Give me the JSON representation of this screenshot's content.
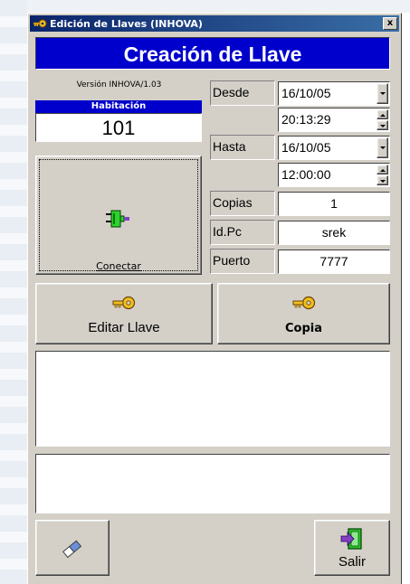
{
  "window": {
    "title": "Edición de Llaves (INHOVA)",
    "close_label": "x"
  },
  "banner": {
    "title": "Creación de Llave"
  },
  "version": "Versión INHOVA/1.03",
  "habitacion": {
    "label": "Habitación",
    "value": "101"
  },
  "conectar": {
    "label": "Conectar"
  },
  "fields": {
    "desde_label": "Desde",
    "desde_date": "16/10/05",
    "desde_time": "20:13:29",
    "hasta_label": "Hasta",
    "hasta_date": "16/10/05",
    "hasta_time": "12:00:00",
    "copias_label": "Copias",
    "copias_value": "1",
    "idpc_label": "Id.Pc",
    "idpc_value": "srek",
    "puerto_label": "Puerto",
    "puerto_value": "7777"
  },
  "buttons": {
    "editar_label": "Editar Llave",
    "copia_label": "Copia",
    "salir_label": "Salir"
  },
  "icons": {
    "title": "key-icon",
    "conectar": "plug-icon",
    "editar": "key-icon",
    "copia": "key-icon",
    "clear": "eraser-icon",
    "salir": "exit-door-icon"
  },
  "colors": {
    "banner": "#0000cc",
    "titlebar": "#0a246a",
    "face": "#d4d0c8"
  }
}
